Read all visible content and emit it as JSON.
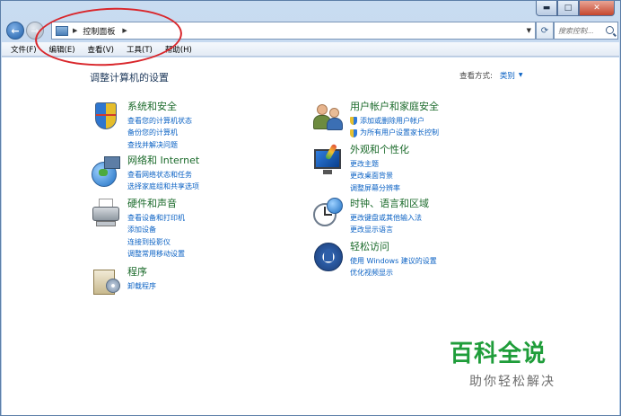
{
  "window": {
    "caption": {
      "minimize": "▬",
      "maximize": "□",
      "close": "✕"
    }
  },
  "navbar": {
    "back_icon": "←",
    "forward_icon": "→",
    "address": {
      "arrow1": "▶",
      "text": "控制面板",
      "arrow2": "▶",
      "dropdown": "▼"
    },
    "refresh_icon": "⟳",
    "search": {
      "placeholder": "搜索控制..."
    }
  },
  "menubar": {
    "items": [
      "文件(F)",
      "编辑(E)",
      "查看(V)",
      "工具(T)",
      "帮助(H)"
    ]
  },
  "content": {
    "page_title": "调整计算机的设置",
    "view_by": {
      "label": "查看方式:",
      "value": "类别",
      "arrow": "▼"
    },
    "left_categories": [
      {
        "title": "系统和安全",
        "links": [
          "查看您的计算机状态",
          "备份您的计算机",
          "查找并解决问题"
        ]
      },
      {
        "title": "网络和 Internet",
        "links": [
          "查看网络状态和任务",
          "选择家庭组和共享选项"
        ]
      },
      {
        "title": "硬件和声音",
        "links": [
          "查看设备和打印机",
          "添加设备",
          "连接到投影仪",
          "调整常用移动设置"
        ]
      },
      {
        "title": "程序",
        "links": [
          "卸载程序"
        ]
      }
    ],
    "right_categories": [
      {
        "title": "用户帐户和家庭安全",
        "links": [
          "添加或删除用户帐户",
          "为所有用户设置家长控制"
        ]
      },
      {
        "title": "外观和个性化",
        "links": [
          "更改主题",
          "更改桌面背景",
          "调整屏幕分辨率"
        ]
      },
      {
        "title": "时钟、语言和区域",
        "links": [
          "更改键盘或其他输入法",
          "更改显示语言"
        ]
      },
      {
        "title": "轻松访问",
        "links": [
          "使用 Windows 建议的设置",
          "优化视频显示"
        ]
      }
    ]
  },
  "watermark": {
    "title": "百科全说",
    "subtitle": "助你轻松解决"
  },
  "colors": {
    "annotation": "#d9262b",
    "category_title": "#1a6a2a",
    "link": "#0b62c4",
    "watermark": "#1f9d3a"
  }
}
